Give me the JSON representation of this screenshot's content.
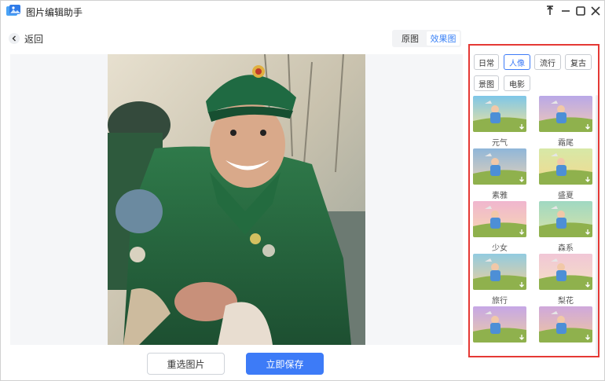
{
  "app": {
    "title": "图片编辑助手",
    "logo_icon": "app-logo-icon"
  },
  "window_controls": [
    "pin-icon",
    "minimize-icon",
    "maximize-icon",
    "close-icon"
  ],
  "nav": {
    "back_label": "返回"
  },
  "view_toggle": {
    "original_label": "原图",
    "effect_label": "效果图",
    "active": "effect"
  },
  "actions": {
    "reselect_label": "重选图片",
    "save_label": "立即保存"
  },
  "filter_categories": [
    {
      "label": "日常",
      "active": false
    },
    {
      "label": "人像",
      "active": true
    },
    {
      "label": "流行",
      "active": false
    },
    {
      "label": "复古",
      "active": false
    },
    {
      "label": "景图",
      "active": false
    },
    {
      "label": "电影",
      "active": false
    }
  ],
  "filters": [
    {
      "label": "元气"
    },
    {
      "label": "霜尾"
    },
    {
      "label": "素雅"
    },
    {
      "label": "盛夏"
    },
    {
      "label": "少女"
    },
    {
      "label": "森系"
    },
    {
      "label": "旅行"
    },
    {
      "label": "梨花"
    },
    {
      "label": ""
    },
    {
      "label": ""
    }
  ],
  "colors": {
    "accent": "#3d7bf7",
    "highlight_outline": "#e53935"
  }
}
